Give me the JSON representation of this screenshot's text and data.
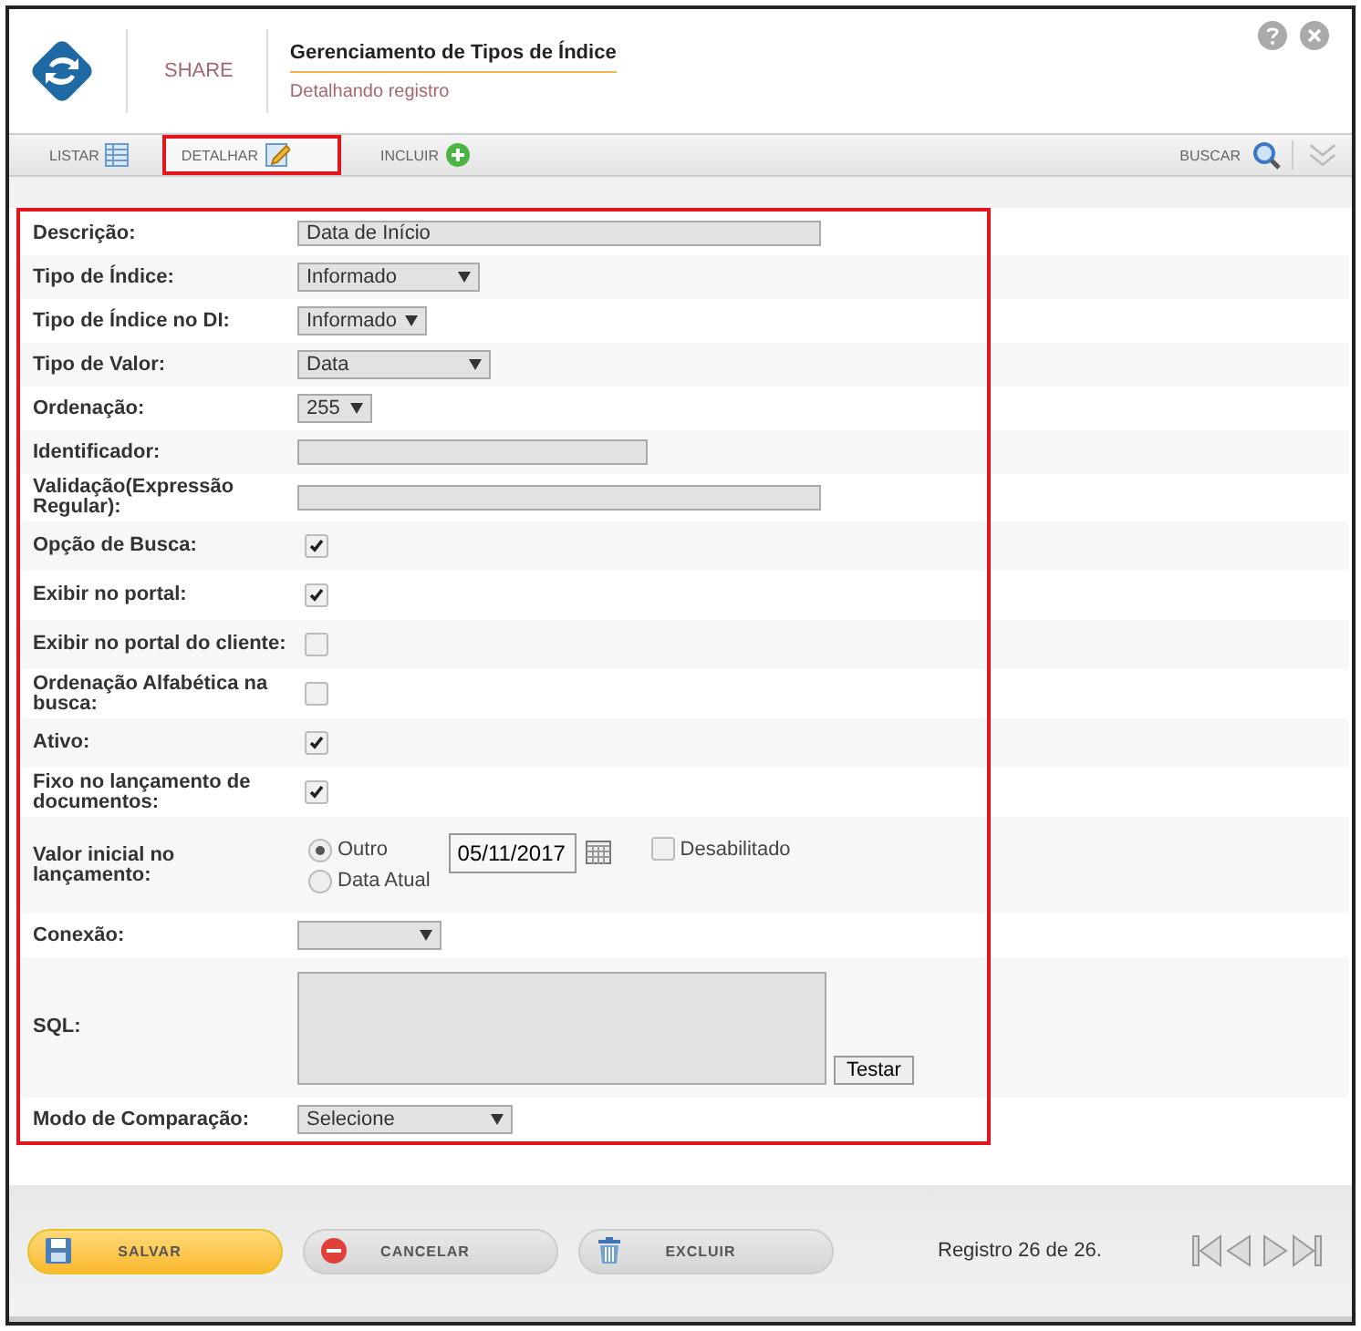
{
  "header": {
    "brand": "SHARE",
    "title": "Gerenciamento de Tipos de Índice",
    "subtitle": "Detalhando registro"
  },
  "tabs": [
    {
      "label": "LISTAR",
      "kind": "list",
      "selected": false,
      "highlight": false
    },
    {
      "label": "DETALHAR",
      "kind": "edit",
      "selected": true,
      "highlight": true
    },
    {
      "label": "INCLUIR",
      "kind": "add",
      "selected": false,
      "highlight": false
    }
  ],
  "search": {
    "label": "BUSCAR"
  },
  "form": {
    "highlight": true,
    "fields": [
      {
        "label": "Descrição:",
        "kind": "text",
        "value": "Data de Início"
      },
      {
        "label": "Tipo de Índice:",
        "kind": "select",
        "value": "Informado"
      },
      {
        "label": "Tipo de Índice no DI:",
        "kind": "select",
        "value": "Informado"
      },
      {
        "label": "Tipo de Valor:",
        "kind": "select",
        "value": "Data"
      },
      {
        "label": "Ordenação:",
        "kind": "select",
        "value": "255"
      },
      {
        "label": "Identificador:",
        "kind": "text"
      },
      {
        "label": "Validação(Expressão Regular):",
        "kind": "text"
      },
      {
        "label": "Opção de Busca:",
        "kind": "checkbox",
        "checked": true
      },
      {
        "label": "Exibir no portal:",
        "kind": "checkbox",
        "checked": true
      },
      {
        "label": "Exibir no portal do cliente:",
        "kind": "checkbox",
        "checked": false
      },
      {
        "label": "Ordenação Alfabética na busca:",
        "kind": "checkbox",
        "checked": false
      },
      {
        "label": "Ativo:",
        "kind": "checkbox",
        "checked": true
      },
      {
        "label": "Fixo no lançamento de documentos:",
        "kind": "checkbox",
        "checked": true
      },
      {
        "label": "Valor inicial no lançamento:",
        "kind": "date",
        "options": [
          {
            "label": "Outro",
            "selected": true
          },
          {
            "label": "Data Atual",
            "selected": false
          }
        ],
        "value": "05/11/2017",
        "disabled_option": {
          "label": "Desabilitado",
          "checked": false
        }
      },
      {
        "label": "Conexão:",
        "kind": "select"
      },
      {
        "label": "SQL:",
        "kind": "textarea",
        "button": "Testar"
      },
      {
        "label": "Modo de Comparação:",
        "kind": "select",
        "value": "Selecione"
      }
    ]
  },
  "footer": {
    "buttons": [
      {
        "label": "SALVAR",
        "kind": "save"
      },
      {
        "label": "CANCELAR",
        "kind": "cancel"
      },
      {
        "label": "EXCLUIR",
        "kind": "delete"
      }
    ],
    "record": "Registro 26 de 26."
  }
}
